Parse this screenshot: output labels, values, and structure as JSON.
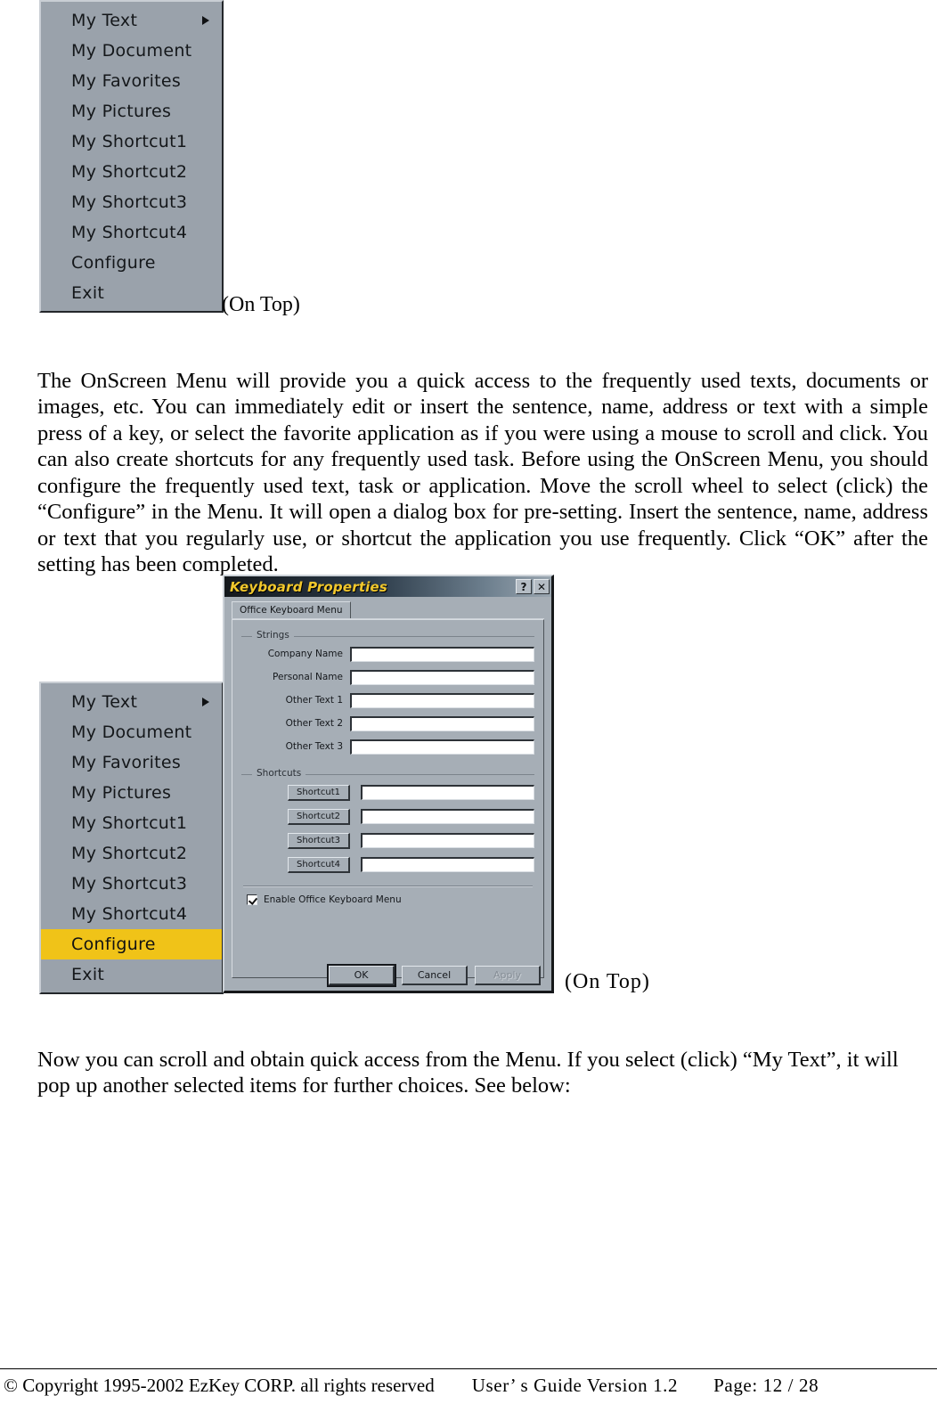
{
  "menu": {
    "items": [
      {
        "label": "My Text",
        "has_submenu": true
      },
      {
        "label": "My Document",
        "has_submenu": false
      },
      {
        "label": "My Favorites",
        "has_submenu": false
      },
      {
        "label": "My Pictures",
        "has_submenu": false
      },
      {
        "label": "My Shortcut1",
        "has_submenu": false
      },
      {
        "label": "My Shortcut2",
        "has_submenu": false
      },
      {
        "label": "My Shortcut3",
        "has_submenu": false
      },
      {
        "label": "My Shortcut4",
        "has_submenu": false
      },
      {
        "label": "Configure",
        "has_submenu": false
      },
      {
        "label": "Exit",
        "has_submenu": false
      }
    ],
    "highlight_color": "#f0c318",
    "background_color": "#9aa2ab",
    "highlighted_item": "Configure"
  },
  "captions": {
    "on_top_1": "(On Top)",
    "on_top_2": "(On Top)"
  },
  "paragraphs": {
    "p1": "The OnScreen Menu will provide you a quick access to the frequently used texts, documents or images, etc. You can immediately edit or insert the sentence, name, address or text with a simple press of a key, or select the favorite application as if you were using a mouse to scroll and click. You can also create shortcuts for any frequently used task. Before using the OnScreen Menu, you should configure the frequently used text, task or application. Move the scroll wheel to select (click) the “Configure” in the Menu. It will open a dialog box for pre-setting. Insert the sentence, name, address or text that you regularly use, or shortcut the application you use frequently. Click “OK” after the setting has been completed.",
    "p2": "Now you can scroll and obtain quick access from the Menu. If you select (click) “My Text”, it will pop up another selected items for further choices. See below:"
  },
  "dialog": {
    "title": "Keyboard Properties",
    "title_color": "#f2c82c",
    "help_button": "?",
    "close_button": "✕",
    "tab": "Office Keyboard Menu",
    "strings_group": "Strings",
    "strings_fields": [
      {
        "label": "Company Name",
        "value": "",
        "placeholder": ""
      },
      {
        "label": "Personal Name",
        "value": "",
        "placeholder": ""
      },
      {
        "label": "Other Text 1",
        "value": "",
        "placeholder": ""
      },
      {
        "label": "Other Text 2",
        "value": "",
        "placeholder": ""
      },
      {
        "label": "Other Text 3",
        "value": "",
        "placeholder": ""
      }
    ],
    "shortcuts_group": "Shortcuts",
    "shortcuts": [
      {
        "button": "Shortcut1",
        "value": "",
        "placeholder": ""
      },
      {
        "button": "Shortcut2",
        "value": "",
        "placeholder": ""
      },
      {
        "button": "Shortcut3",
        "value": "",
        "placeholder": ""
      },
      {
        "button": "Shortcut4",
        "value": "",
        "placeholder": ""
      }
    ],
    "enable_checkbox": {
      "label": "Enable Office Keyboard Menu",
      "checked": true
    },
    "buttons": {
      "ok": "OK",
      "cancel": "Cancel",
      "apply": "Apply"
    }
  },
  "footer": {
    "copyright": "© Copyright 1995-2002 EzKey CORP. all rights reserved",
    "guide": "User’ s  Guide  Version  1.2",
    "page": "Page:  12 / 28"
  }
}
